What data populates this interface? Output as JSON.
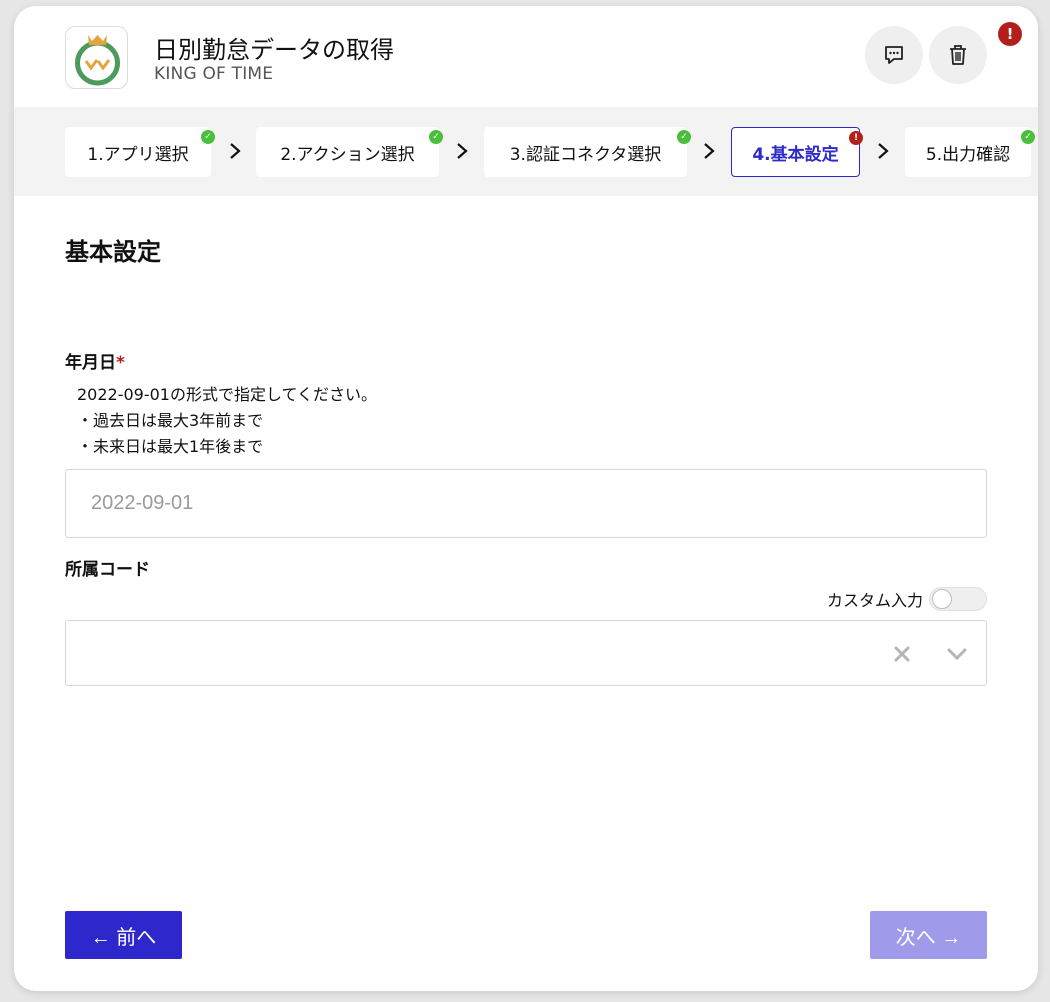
{
  "header": {
    "title": "日別勤怠データの取得",
    "subtitle": "KING OF TIME",
    "app_icon": "king-of-time-logo",
    "alert_badge": "!"
  },
  "steps": [
    {
      "label": "1.アプリ選択",
      "status": "ok"
    },
    {
      "label": "2.アクション選択",
      "status": "ok"
    },
    {
      "label": "3.認証コネクタ選択",
      "status": "ok"
    },
    {
      "label": "4.基本設定",
      "status": "error",
      "active": true
    },
    {
      "label": "5.出力確認",
      "status": "ok"
    }
  ],
  "section": {
    "title": "基本設定"
  },
  "date_field": {
    "label": "年月日",
    "required_mark": "*",
    "help": [
      "2022-09-01の形式で指定してください。",
      "・過去日は最大3年前まで",
      "・未来日は最大1年後まで"
    ],
    "placeholder": "2022-09-01",
    "value": ""
  },
  "code_field": {
    "label": "所属コード",
    "custom_input_label": "カスタム入力",
    "custom_input_on": false,
    "value": ""
  },
  "buttons": {
    "prev": "← 前へ",
    "next": "次へ →"
  },
  "colors": {
    "accent": "#2e27cc",
    "accent_disabled": "#9f9bea",
    "ok": "#4bbf3c",
    "error": "#b3201b"
  }
}
